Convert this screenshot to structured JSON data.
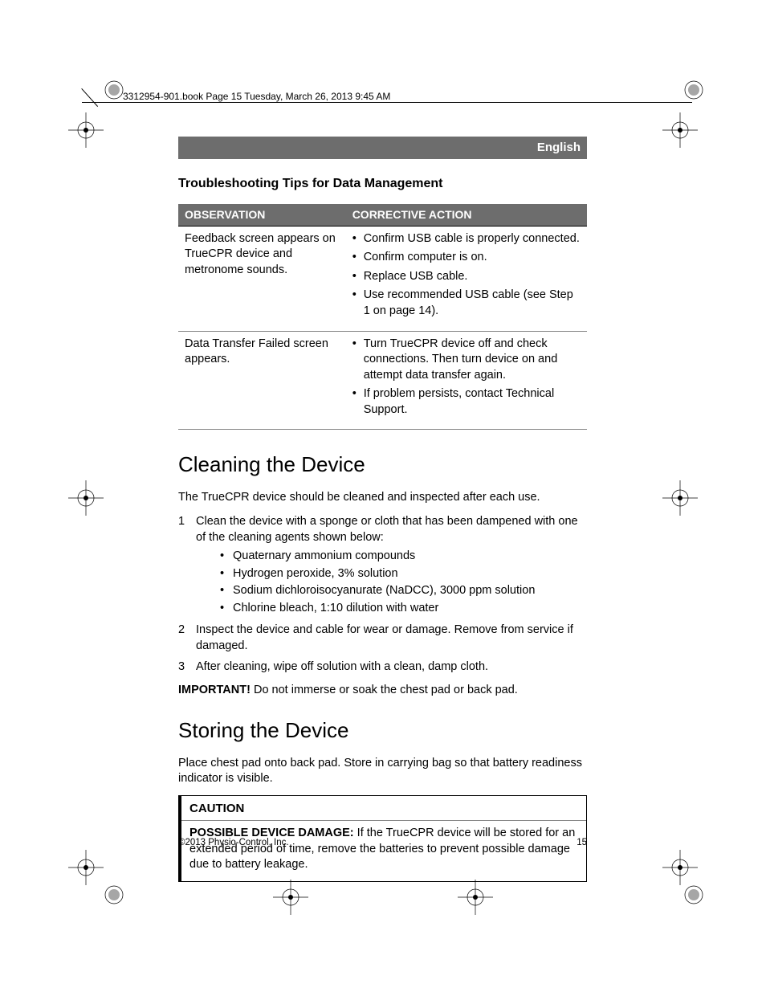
{
  "book_header": "3312954-901.book  Page 15  Tuesday, March 26, 2013  9:45 AM",
  "language_label": "English",
  "section_title": "Troubleshooting Tips for Data Management",
  "table": {
    "head": {
      "col1": "OBSERVATION",
      "col2": "CORRECTIVE ACTION"
    },
    "rows": [
      {
        "observation": "Feedback screen appears on TrueCPR device and metronome sounds.",
        "actions": [
          "Confirm USB cable is properly connected.",
          "Confirm computer is on.",
          "Replace USB cable.",
          "Use recommended USB cable (see Step 1 on page 14)."
        ]
      },
      {
        "observation": "Data Transfer Failed screen appears.",
        "actions": [
          "Turn TrueCPR device off and check connections. Then turn device on and attempt data transfer again.",
          "If problem persists, contact Technical Support."
        ]
      }
    ]
  },
  "cleaning": {
    "heading": "Cleaning the Device",
    "intro": "The TrueCPR device should be cleaned and inspected after each use.",
    "steps": [
      {
        "num": "1",
        "text": "Clean the device with a sponge or cloth that has been dampened with one of the cleaning agents shown below:",
        "bullets": [
          "Quaternary ammonium compounds",
          "Hydrogen peroxide, 3% solution",
          "Sodium dichloroisocyanurate (NaDCC), 3000 ppm solution",
          "Chlorine bleach, 1:10 dilution with water"
        ]
      },
      {
        "num": "2",
        "text": "Inspect the device and cable for wear or damage. Remove from service if damaged."
      },
      {
        "num": "3",
        "text": "After cleaning, wipe off solution with a clean, damp cloth."
      }
    ],
    "important_label": "IMPORTANT!",
    "important_text": "  Do not immerse or soak the chest pad or back pad."
  },
  "storing": {
    "heading": "Storing the Device",
    "intro": "Place chest pad onto back pad. Store in carrying bag so that battery readiness indicator is visible.",
    "caution_label": "CAUTION",
    "caution_bold": "POSSIBLE DEVICE DAMAGE:",
    "caution_text": "  If the TrueCPR device will be stored for an extended period of time, remove the batteries to prevent possible damage due to battery leakage."
  },
  "footer": {
    "copyright": "©2013 Physio-Control, Inc.",
    "page": "15"
  }
}
